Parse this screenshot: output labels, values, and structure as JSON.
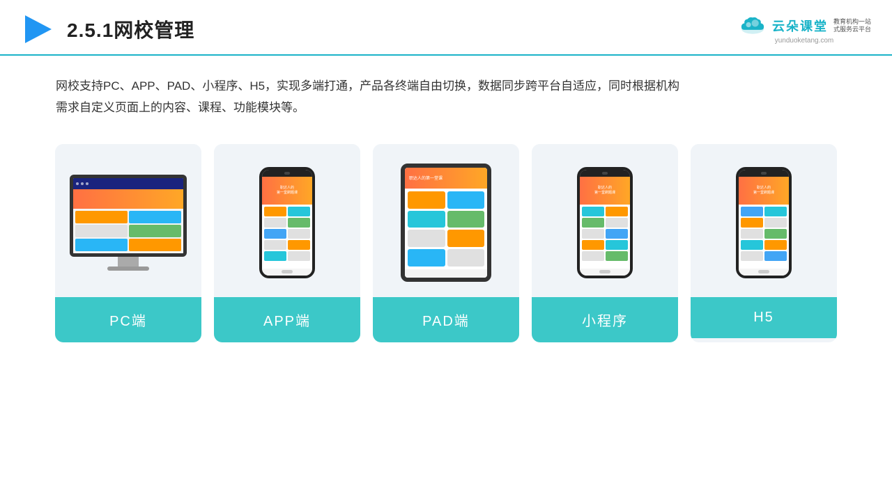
{
  "header": {
    "title": "2.5.1网校管理",
    "brand_name": "云朵课堂",
    "brand_url": "yunduoketang.com",
    "brand_slogan_line1": "教育机构一站",
    "brand_slogan_line2": "式服务云平台"
  },
  "description": {
    "text_line1": "网校支持PC、APP、PAD、小程序、H5，实现多端打通，产品各终端自由切换，数据同步跨平台自适应，同时根据机构",
    "text_line2": "需求自定义页面上的内容、课程、功能模块等。"
  },
  "cards": [
    {
      "id": "pc",
      "label": "PC端",
      "device": "monitor"
    },
    {
      "id": "app",
      "label": "APP端",
      "device": "phone"
    },
    {
      "id": "pad",
      "label": "PAD端",
      "device": "tablet"
    },
    {
      "id": "miniprogram",
      "label": "小程序",
      "device": "phone2"
    },
    {
      "id": "h5",
      "label": "H5",
      "device": "phone3"
    }
  ],
  "colors": {
    "accent": "#3cc8c8",
    "header_line": "#1ab3c8",
    "arrow": "#2196f3",
    "text_dark": "#222222",
    "text_body": "#333333",
    "card_bg": "#f0f4f8"
  }
}
